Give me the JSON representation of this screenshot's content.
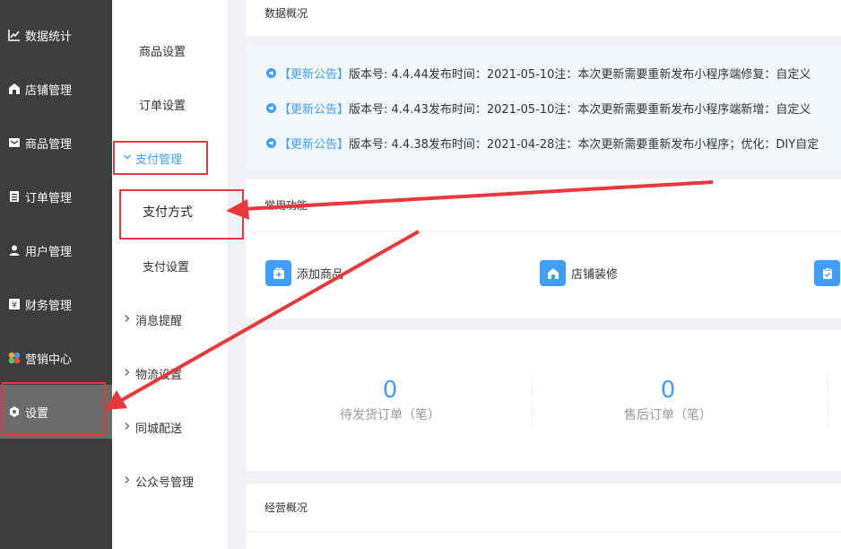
{
  "nav": {
    "items": [
      {
        "label": "数据统计",
        "icon": "line-chart-icon"
      },
      {
        "label": "店铺管理",
        "icon": "shop-icon"
      },
      {
        "label": "商品管理",
        "icon": "goods-icon"
      },
      {
        "label": "订单管理",
        "icon": "order-icon"
      },
      {
        "label": "用户管理",
        "icon": "user-icon"
      },
      {
        "label": "财务管理",
        "icon": "yen-icon"
      },
      {
        "label": "营销中心",
        "icon": "marketing-icon"
      },
      {
        "label": "设置",
        "icon": "gear-icon"
      }
    ]
  },
  "submenu": {
    "items": [
      {
        "label": "商品设置"
      },
      {
        "label": "订单设置"
      },
      {
        "label": "支付管理"
      },
      {
        "label": "支付方式"
      },
      {
        "label": "支付设置"
      },
      {
        "label": "消息提醒"
      },
      {
        "label": "物流设置"
      },
      {
        "label": "同城配送"
      },
      {
        "label": "公众号管理"
      }
    ]
  },
  "main": {
    "overview_title": "数据概况",
    "notices": [
      {
        "tag": "【更新公告】",
        "text": "版本号: 4.4.44发布时间：2021-05-10注：本次更新需要重新发布小程序端修复：自定义"
      },
      {
        "tag": "【更新公告】",
        "text": "版本号: 4.4.43发布时间：2021-05-10注：本次更新需要重新发布小程序端新增：自定义"
      },
      {
        "tag": "【更新公告】",
        "text": "版本号: 4.4.38发布时间：2021-04-28注：本次更新需要重新发布小程序；优化：DIY自定"
      }
    ],
    "common_title": "常用功能",
    "functions": [
      {
        "label": "添加商品",
        "icon": "add-goods-icon"
      },
      {
        "label": "店铺装修",
        "icon": "store-decor-icon"
      },
      {
        "label": "",
        "icon": "clipboard-icon"
      }
    ],
    "stats": [
      {
        "value": "0",
        "label": "待发货订单（笔）"
      },
      {
        "value": "0",
        "label": "售后订单（笔）"
      }
    ],
    "business_title": "经营概况"
  },
  "colors": {
    "accent": "#409eff",
    "highlight": "#e9383c",
    "nav_bg": "#3d3d3d",
    "nav_active": "#6b6b6b"
  }
}
